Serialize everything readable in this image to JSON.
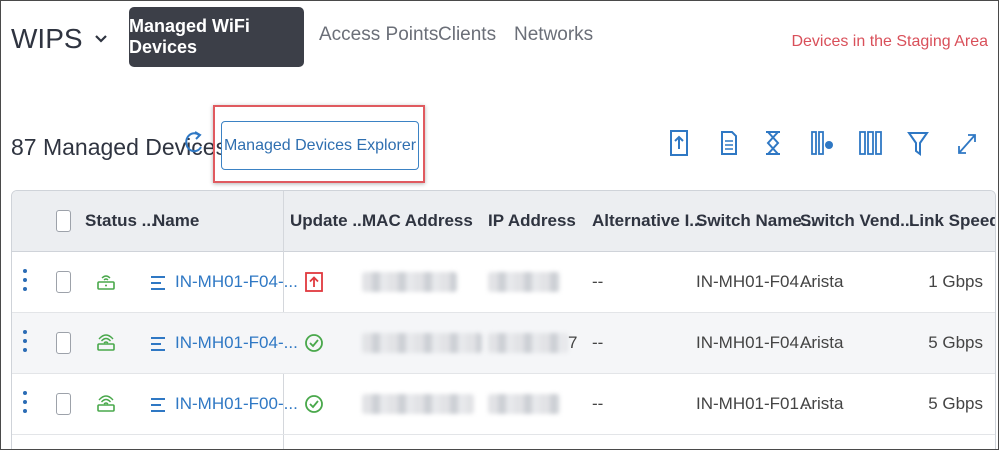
{
  "nav": {
    "app_title": "WIPS",
    "tabs": [
      {
        "label": "Managed WiFi Devices",
        "active": true
      },
      {
        "label": "Access Points",
        "active": false
      },
      {
        "label": "Clients",
        "active": false
      },
      {
        "label": "Networks",
        "active": false
      }
    ],
    "staging_link": "Devices in the Staging Area"
  },
  "toolbar": {
    "count_title": "87 Managed Devices",
    "explorer_button": "Managed Devices Explorer",
    "icons": [
      "export-icon",
      "report-icon",
      "history-icon",
      "column-settings-icon",
      "columns-icon",
      "filter-icon",
      "expand-icon"
    ]
  },
  "table": {
    "columns": [
      "Status ...",
      "Name",
      "Update ...",
      "MAC Address",
      "IP Address",
      "Alternative I...",
      "Switch Name...",
      "Switch Vend...",
      "Link Speed"
    ],
    "rows": [
      {
        "name": "IN-MH01-F04-...",
        "update": "upgrade-available",
        "ip_tail": "",
        "alternative": "--",
        "switch_name": "IN-MH01-F04...",
        "switch_vendor": "Arista",
        "link_speed": "1 Gbps",
        "status": "device-offline"
      },
      {
        "name": "IN-MH01-F04-...",
        "update": "up-to-date",
        "ip_tail": "7",
        "alternative": "--",
        "switch_name": "IN-MH01-F04...",
        "switch_vendor": "Arista",
        "link_speed": "5 Gbps",
        "status": "device-online"
      },
      {
        "name": "IN-MH01-F00-...",
        "update": "up-to-date",
        "ip_tail": "",
        "alternative": "--",
        "switch_name": "IN-MH01-F01...",
        "switch_vendor": "Arista",
        "link_speed": "5 Gbps",
        "status": "device-online"
      }
    ]
  },
  "colors": {
    "accent": "#2f78c4",
    "active_tab_bg": "#3c3f48",
    "staging_link": "#d9505a",
    "highlight": "#e05a5f",
    "status_green": "#49a84b",
    "update_red": "#e0393e"
  }
}
